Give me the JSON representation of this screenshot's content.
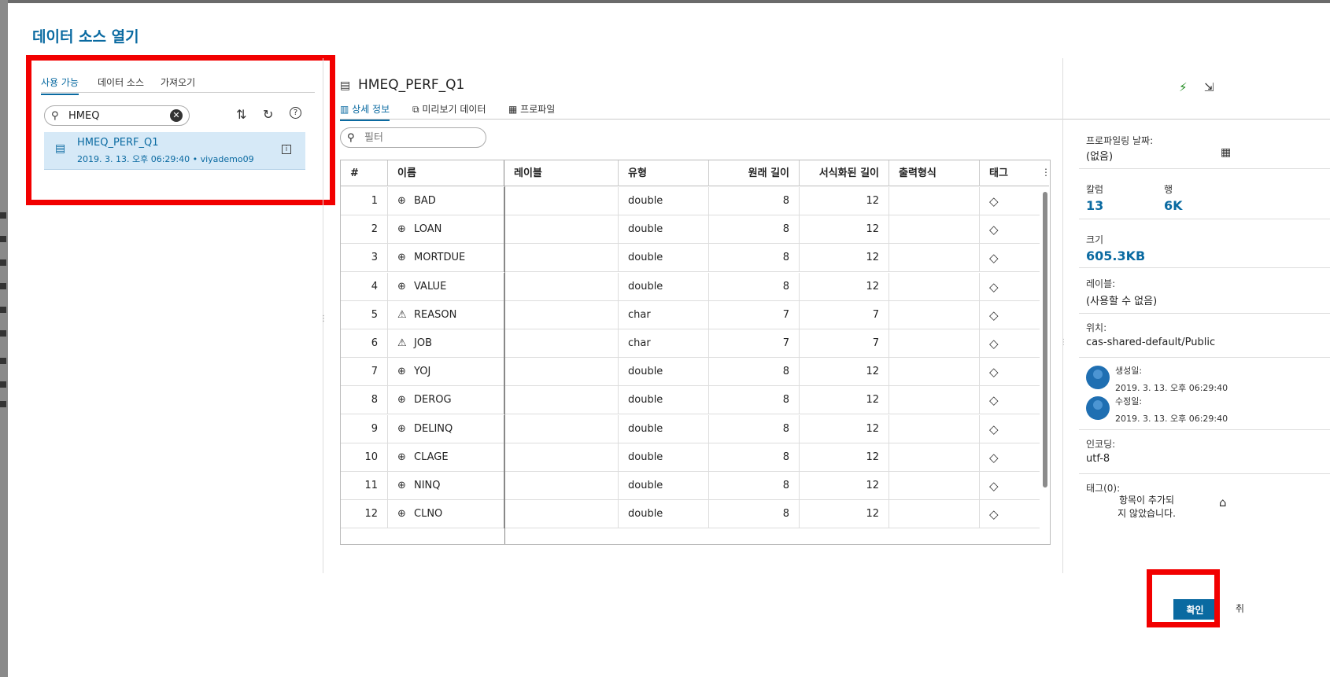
{
  "dialog": {
    "title": "데이터 소스 열기"
  },
  "left": {
    "tabs": [
      "사용 가능",
      "데이터 소스",
      "가져오기"
    ],
    "search": {
      "value": "HMEQ"
    },
    "result": {
      "name": "HMEQ_PERF_Q1",
      "meta": "2019. 3. 13. 오후 06:29:40 • viyademo09"
    }
  },
  "main": {
    "title": "HMEQ_PERF_Q1",
    "tabs": [
      "상세 정보",
      "미리보기 데이터",
      "프로파일"
    ],
    "filter_placeholder": "필터",
    "columns": [
      "#",
      "이름",
      "레이블",
      "유형",
      "원래 길이",
      "서식화된 길이",
      "출력형식",
      "태그"
    ],
    "rows": [
      {
        "n": "1",
        "name": "BAD",
        "type": "double",
        "len": "8",
        "flen": "12",
        "kind": "num"
      },
      {
        "n": "2",
        "name": "LOAN",
        "type": "double",
        "len": "8",
        "flen": "12",
        "kind": "num"
      },
      {
        "n": "3",
        "name": "MORTDUE",
        "type": "double",
        "len": "8",
        "flen": "12",
        "kind": "num"
      },
      {
        "n": "4",
        "name": "VALUE",
        "type": "double",
        "len": "8",
        "flen": "12",
        "kind": "num"
      },
      {
        "n": "5",
        "name": "REASON",
        "type": "char",
        "len": "7",
        "flen": "7",
        "kind": "char"
      },
      {
        "n": "6",
        "name": "JOB",
        "type": "char",
        "len": "7",
        "flen": "7",
        "kind": "char"
      },
      {
        "n": "7",
        "name": "YOJ",
        "type": "double",
        "len": "8",
        "flen": "12",
        "kind": "num"
      },
      {
        "n": "8",
        "name": "DEROG",
        "type": "double",
        "len": "8",
        "flen": "12",
        "kind": "num"
      },
      {
        "n": "9",
        "name": "DELINQ",
        "type": "double",
        "len": "8",
        "flen": "12",
        "kind": "num"
      },
      {
        "n": "10",
        "name": "CLAGE",
        "type": "double",
        "len": "8",
        "flen": "12",
        "kind": "num"
      },
      {
        "n": "11",
        "name": "NINQ",
        "type": "double",
        "len": "8",
        "flen": "12",
        "kind": "num"
      },
      {
        "n": "12",
        "name": "CLNO",
        "type": "double",
        "len": "8",
        "flen": "12",
        "kind": "num"
      }
    ]
  },
  "props": {
    "profile_date_label": "프로파일링 날짜:",
    "profile_date_value": "(없음)",
    "columns_label": "칼럼",
    "columns_value": "13",
    "rows_label": "행",
    "rows_value": "6K",
    "size_label": "크기",
    "size_value": "605.3KB",
    "label_label": "레이블:",
    "label_value": "(사용할 수 없음)",
    "location_label": "위치:",
    "location_value": "cas-shared-default/Public",
    "created_label": "생성일:",
    "created_value": "2019. 3. 13. 오후 06:29:40",
    "modified_label": "수정일:",
    "modified_value": "2019. 3. 13. 오후 06:29:40",
    "encoding_label": "인코딩:",
    "encoding_value": "utf-8",
    "tags_label": "태그(0):",
    "tags_empty": "항목이 추가되지 않았습니다."
  },
  "buttons": {
    "ok": "확인",
    "cancel_peek": "취"
  },
  "colors": {
    "accent": "#0a6aa1",
    "highlight": "#f20000",
    "selected_row": "#d6e9f7"
  }
}
